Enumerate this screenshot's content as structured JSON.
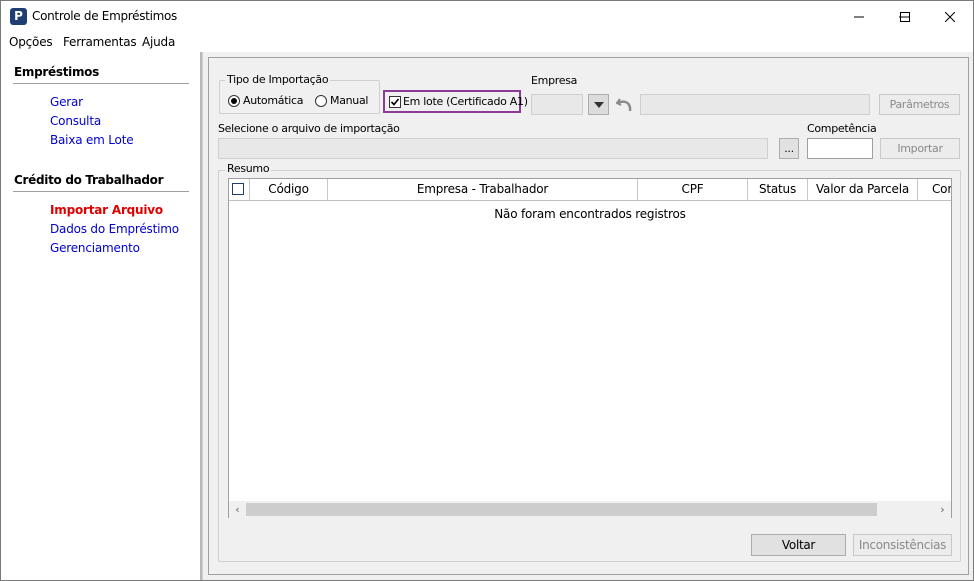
{
  "window": {
    "title": "Controle de Empréstimos",
    "icon_letter": "P",
    "minimize_icon": "minimize-icon",
    "maximize_icon": "maximize-icon",
    "close_icon": "close-icon"
  },
  "menu": {
    "items": [
      "Opções",
      "Ferramentas",
      "Ajuda"
    ]
  },
  "sidebar": {
    "sections": [
      {
        "heading": "Empréstimos",
        "links": [
          "Gerar",
          "Consulta",
          "Baixa em Lote"
        ]
      },
      {
        "heading": "Crédito do Trabalhador",
        "links": [
          "Importar Arquivo",
          "Dados do Empréstimo",
          "Gerenciamento"
        ]
      }
    ],
    "active_link": "Importar Arquivo",
    "link_color": "#0000d0",
    "active_color": "#e00000"
  },
  "import": {
    "type_legend": "Tipo de Importação",
    "option_auto": "Automática",
    "option_manual": "Manual",
    "selected": "Automática",
    "batch_checkbox_label": "Em lote (Certificado A1)",
    "batch_checked": true,
    "highlight_color": "#8b3a96",
    "empresa_label": "Empresa",
    "parametros_button": "Parâmetros",
    "file_label": "Selecione o arquivo de importação",
    "browse_button": "...",
    "competencia_label": "Competência",
    "importar_button": "Importar"
  },
  "resumo": {
    "legend": "Resumo",
    "columns": [
      "Código",
      "Empresa - Trabalhador",
      "CPF",
      "Status",
      "Valor da Parcela",
      "Cor"
    ],
    "empty_message": "Não foram encontrados registros",
    "scroll_left": "‹",
    "scroll_right": "›"
  },
  "footer": {
    "voltar_button": "Voltar",
    "inconsistencias_button": "Inconsistências"
  }
}
